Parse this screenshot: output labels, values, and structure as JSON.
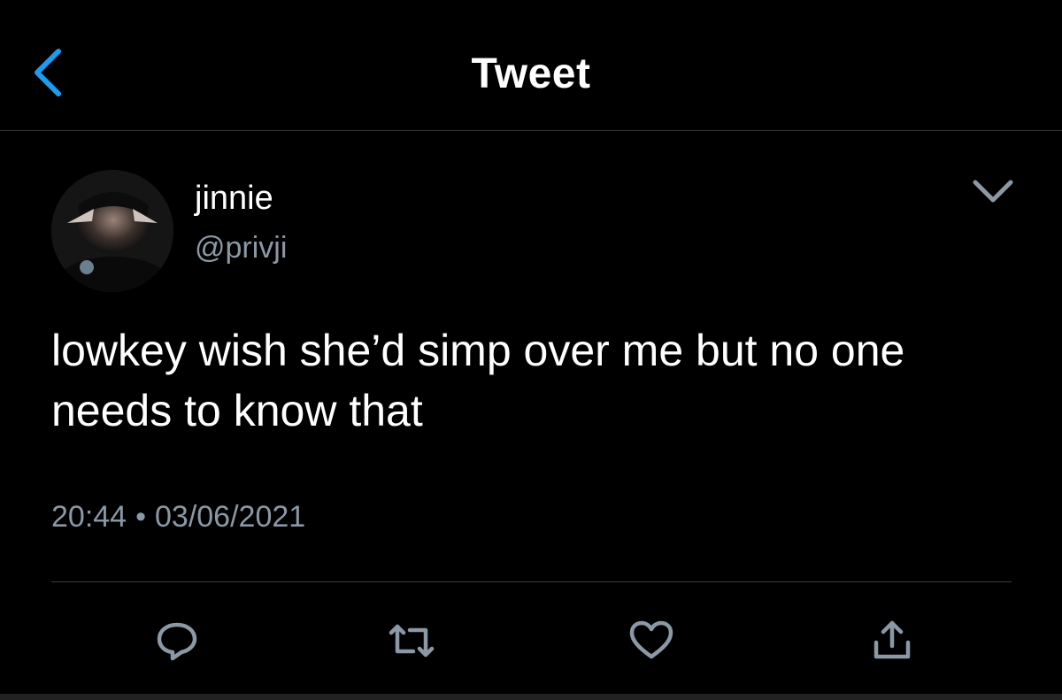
{
  "header": {
    "title": "Tweet",
    "back_icon": "chevron-left-icon"
  },
  "tweet": {
    "display_name": "jinnie",
    "handle": "@privji",
    "text": "lowkey wish she’d simp over me but no one needs to know that",
    "time": "20:44",
    "separator": "•",
    "date": "03/06/2021"
  },
  "actions": [
    {
      "name": "reply",
      "icon": "reply-icon"
    },
    {
      "name": "retweet",
      "icon": "retweet-icon"
    },
    {
      "name": "like",
      "icon": "heart-icon"
    },
    {
      "name": "share",
      "icon": "share-icon"
    }
  ],
  "colors": {
    "background": "#000000",
    "accent": "#1d9bf0",
    "secondary_text": "#8b98a5",
    "divider": "#3a3f44"
  }
}
